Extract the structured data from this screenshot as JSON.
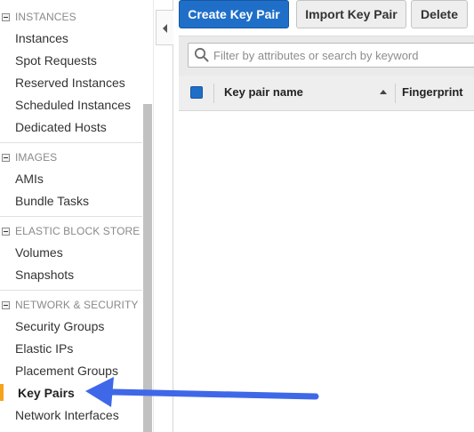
{
  "sidebar": {
    "sections": [
      {
        "title": "INSTANCES",
        "items": [
          "Instances",
          "Spot Requests",
          "Reserved Instances",
          "Scheduled Instances",
          "Dedicated Hosts"
        ]
      },
      {
        "title": "IMAGES",
        "items": [
          "AMIs",
          "Bundle Tasks"
        ]
      },
      {
        "title": "ELASTIC BLOCK STORE",
        "items": [
          "Volumes",
          "Snapshots"
        ]
      },
      {
        "title": "NETWORK & SECURITY",
        "items": [
          "Security Groups",
          "Elastic IPs",
          "Placement Groups",
          "Key Pairs",
          "Network Interfaces"
        ]
      }
    ],
    "active_item": "Key Pairs"
  },
  "toolbar": {
    "create_label": "Create Key Pair",
    "import_label": "Import Key Pair",
    "delete_label": "Delete"
  },
  "filter": {
    "placeholder": "Filter by attributes or search by keyword",
    "value": ""
  },
  "table": {
    "columns": [
      "Key pair name",
      "Fingerprint"
    ],
    "sort_column": "Key pair name",
    "sort_direction": "ascending",
    "rows": []
  },
  "colors": {
    "primary": "#1f6fc9",
    "active_indicator": "#f7a21b",
    "annotation_arrow": "#3f68e8"
  },
  "icons": [
    "collapse-icon",
    "chevron-left-icon",
    "search-icon",
    "sort-ascending-icon",
    "annotation-arrow-icon"
  ]
}
